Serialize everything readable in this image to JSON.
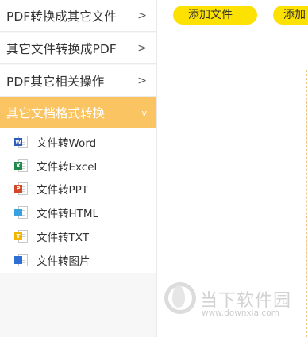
{
  "sidebar": {
    "menu": [
      {
        "label": "PDF转换成其它文件",
        "arrow": ">"
      },
      {
        "label": "其它文件转换成PDF",
        "arrow": ">"
      },
      {
        "label": "PDF其它相关操作",
        "arrow": ">"
      },
      {
        "label": "其它文档格式转换",
        "arrow": "v"
      }
    ],
    "sub_items": [
      {
        "label": "文件转Word",
        "icon": "word-file-icon",
        "tag": "W",
        "color": "#2b5bbd"
      },
      {
        "label": "文件转Excel",
        "icon": "excel-file-icon",
        "tag": "X",
        "color": "#1e8a4c"
      },
      {
        "label": "文件转PPT",
        "icon": "ppt-file-icon",
        "tag": "P",
        "color": "#d24726"
      },
      {
        "label": "文件转HTML",
        "icon": "html-file-icon",
        "tag": "",
        "color": "#36a3e0"
      },
      {
        "label": "文件转TXT",
        "icon": "txt-file-icon",
        "tag": "T",
        "color": "#f2b500"
      },
      {
        "label": "文件转图片",
        "icon": "image-file-icon",
        "tag": "",
        "color": "#2f6fd1"
      }
    ]
  },
  "main": {
    "add_file_label": "添加文件",
    "add_folder_label": "添加"
  },
  "watermark": {
    "title": "当下软件园",
    "url": "www.downxia.com",
    "logo_icon": "downxia-logo-icon"
  },
  "colors": {
    "active_menu_bg": "#fbc462",
    "button_bg": "#fde100",
    "dashed_border": "#f3c487"
  }
}
